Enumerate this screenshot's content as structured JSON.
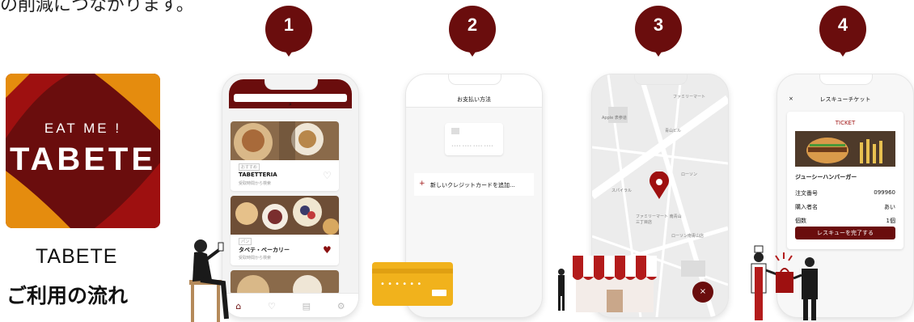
{
  "top_text": "の削減につながります。",
  "logo": {
    "eyebrow": "EAT ME !",
    "brand": "TABETE"
  },
  "caption": {
    "line1": "TABETE",
    "line2": "ご利用の流れ"
  },
  "steps": [
    "1",
    "2",
    "3",
    "4"
  ],
  "colors": {
    "maroon": "#6a0d0d",
    "red": "#9e1010",
    "orange": "#e58c0e",
    "card_yellow": "#f1b21c"
  },
  "phone1": {
    "search_icon": "search-icon",
    "store1_tag": "おすすめ",
    "store1_name": "TABETTERIA",
    "store1_sub": "受取時間から検索",
    "store2_tag": "パン",
    "store2_name": "タベテ・ベーカリー",
    "store2_sub": "受取時間から検索"
  },
  "phone2": {
    "title": "お支払い方法",
    "card_number": "•••• •••• •••• ••••",
    "add_card": "新しいクレジットカードを追加..."
  },
  "phone3": {
    "map_labels": [
      "Apple 表参道",
      "ファミリーマート",
      "ローソン",
      "スパイラル",
      "ファミリーマート 南青山三丁目店",
      "ローソン南青山店",
      "青山ビル",
      "TABETE"
    ]
  },
  "phone4": {
    "close": "×",
    "title": "レスキューチケット",
    "ticket_label": "TICKET",
    "item": "ジューシーハンバーガー",
    "rows": [
      {
        "label": "注文番号",
        "value": "099960"
      },
      {
        "label": "購入者名",
        "value": "あい"
      },
      {
        "label": "個数",
        "value": "1個"
      }
    ],
    "complete_button": "レスキューを完了する"
  }
}
